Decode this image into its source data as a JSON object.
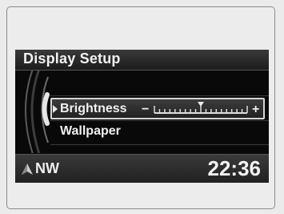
{
  "screen": {
    "title": "Display Setup",
    "menu": {
      "items": [
        {
          "label": "Brightness",
          "selected": true,
          "control": "slider"
        },
        {
          "label": "Wallpaper",
          "selected": false
        }
      ]
    },
    "brightness_slider": {
      "minus_symbol": "−",
      "plus_symbol": "+",
      "level_fraction": 0.5
    },
    "footer": {
      "compass_icon": "triangle-north-arrow",
      "heading": "NW",
      "clock": "22:36"
    }
  }
}
